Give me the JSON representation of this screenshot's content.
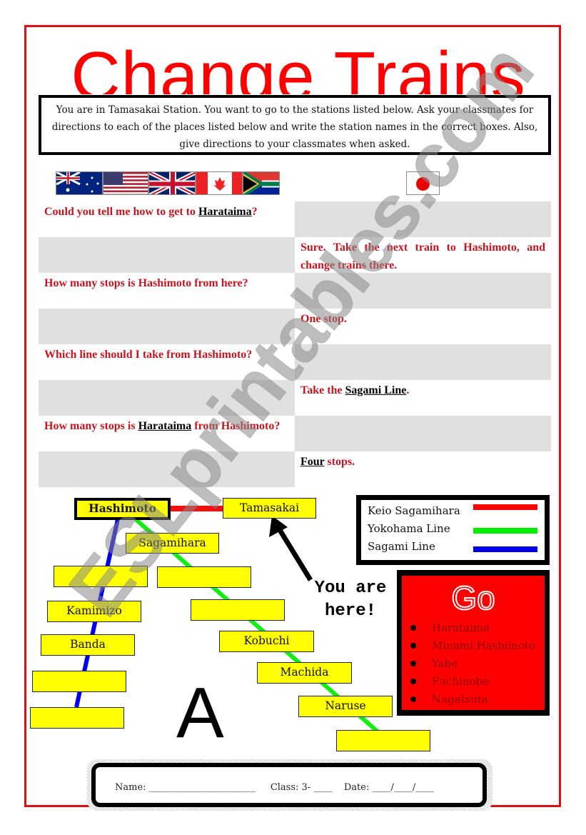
{
  "page": {
    "title": "Change Trains",
    "instructions": "You are in Tamasakai Station. You want to go to the stations listed below. Ask your classmates for directions to each of the places listed below and write the station names in the correct boxes. Also, give directions to your classmates when asked."
  },
  "flags": {
    "english_speaking": [
      "australia-flag",
      "usa-flag",
      "uk-flag",
      "canada-flag",
      "south-africa-flag"
    ],
    "japanese": "japan-flag"
  },
  "dialog": [
    {
      "side": "left",
      "parts": [
        {
          "t": "Could you tell me how to get to "
        },
        {
          "t": "Harataima",
          "u": true
        },
        {
          "t": "?"
        }
      ]
    },
    {
      "side": "right",
      "parts": [
        {
          "t": "Sure. Take the next train to Hashimoto, and change trains there."
        }
      ]
    },
    {
      "side": "left",
      "parts": [
        {
          "t": "How many stops is Hashimoto from here?"
        }
      ]
    },
    {
      "side": "right",
      "parts": [
        {
          "t": "One stop."
        }
      ]
    },
    {
      "side": "left",
      "parts": [
        {
          "t": "Which line should I take from Hashimoto?"
        }
      ]
    },
    {
      "side": "right",
      "parts": [
        {
          "t": "Take the "
        },
        {
          "t": "Sagami Line",
          "u": true
        },
        {
          "t": "."
        }
      ]
    },
    {
      "side": "left",
      "parts": [
        {
          "t": "How many stops is "
        },
        {
          "t": "Harataima",
          "u": true
        },
        {
          "t": " from Hashimoto?"
        }
      ]
    },
    {
      "side": "right",
      "parts": [
        {
          "t": "Four",
          "u": true
        },
        {
          "t": " stops."
        }
      ]
    }
  ],
  "map": {
    "stations": {
      "hashimoto": "Hashimoto",
      "tamasakai": "Tamasakai",
      "sagamihara": "Sagamihara",
      "kamimizo": "Kamimizo",
      "banda": "Banda",
      "kobuchi": "Kobuchi",
      "machida": "Machida",
      "naruse": "Naruse",
      "blank": ""
    },
    "you_are_here": "You are here!",
    "map_label": "A"
  },
  "legend": {
    "items": [
      {
        "label": "Keio Sagamihara",
        "color": "#ff0000"
      },
      {
        "label": "Yokohama Line",
        "color": "#00ee00"
      },
      {
        "label": "Sagami Line",
        "color": "#0000ee"
      }
    ]
  },
  "go": {
    "title": "Go",
    "destinations": [
      "Harataima",
      "Minami Hashimoto",
      "Yabe",
      "Fuchinobe",
      "Nagatsuta"
    ]
  },
  "footer": {
    "text": "Name: _______________________     Class: 3- ____    Date: ____/____/____"
  },
  "watermark": "ESLprintables.com"
}
